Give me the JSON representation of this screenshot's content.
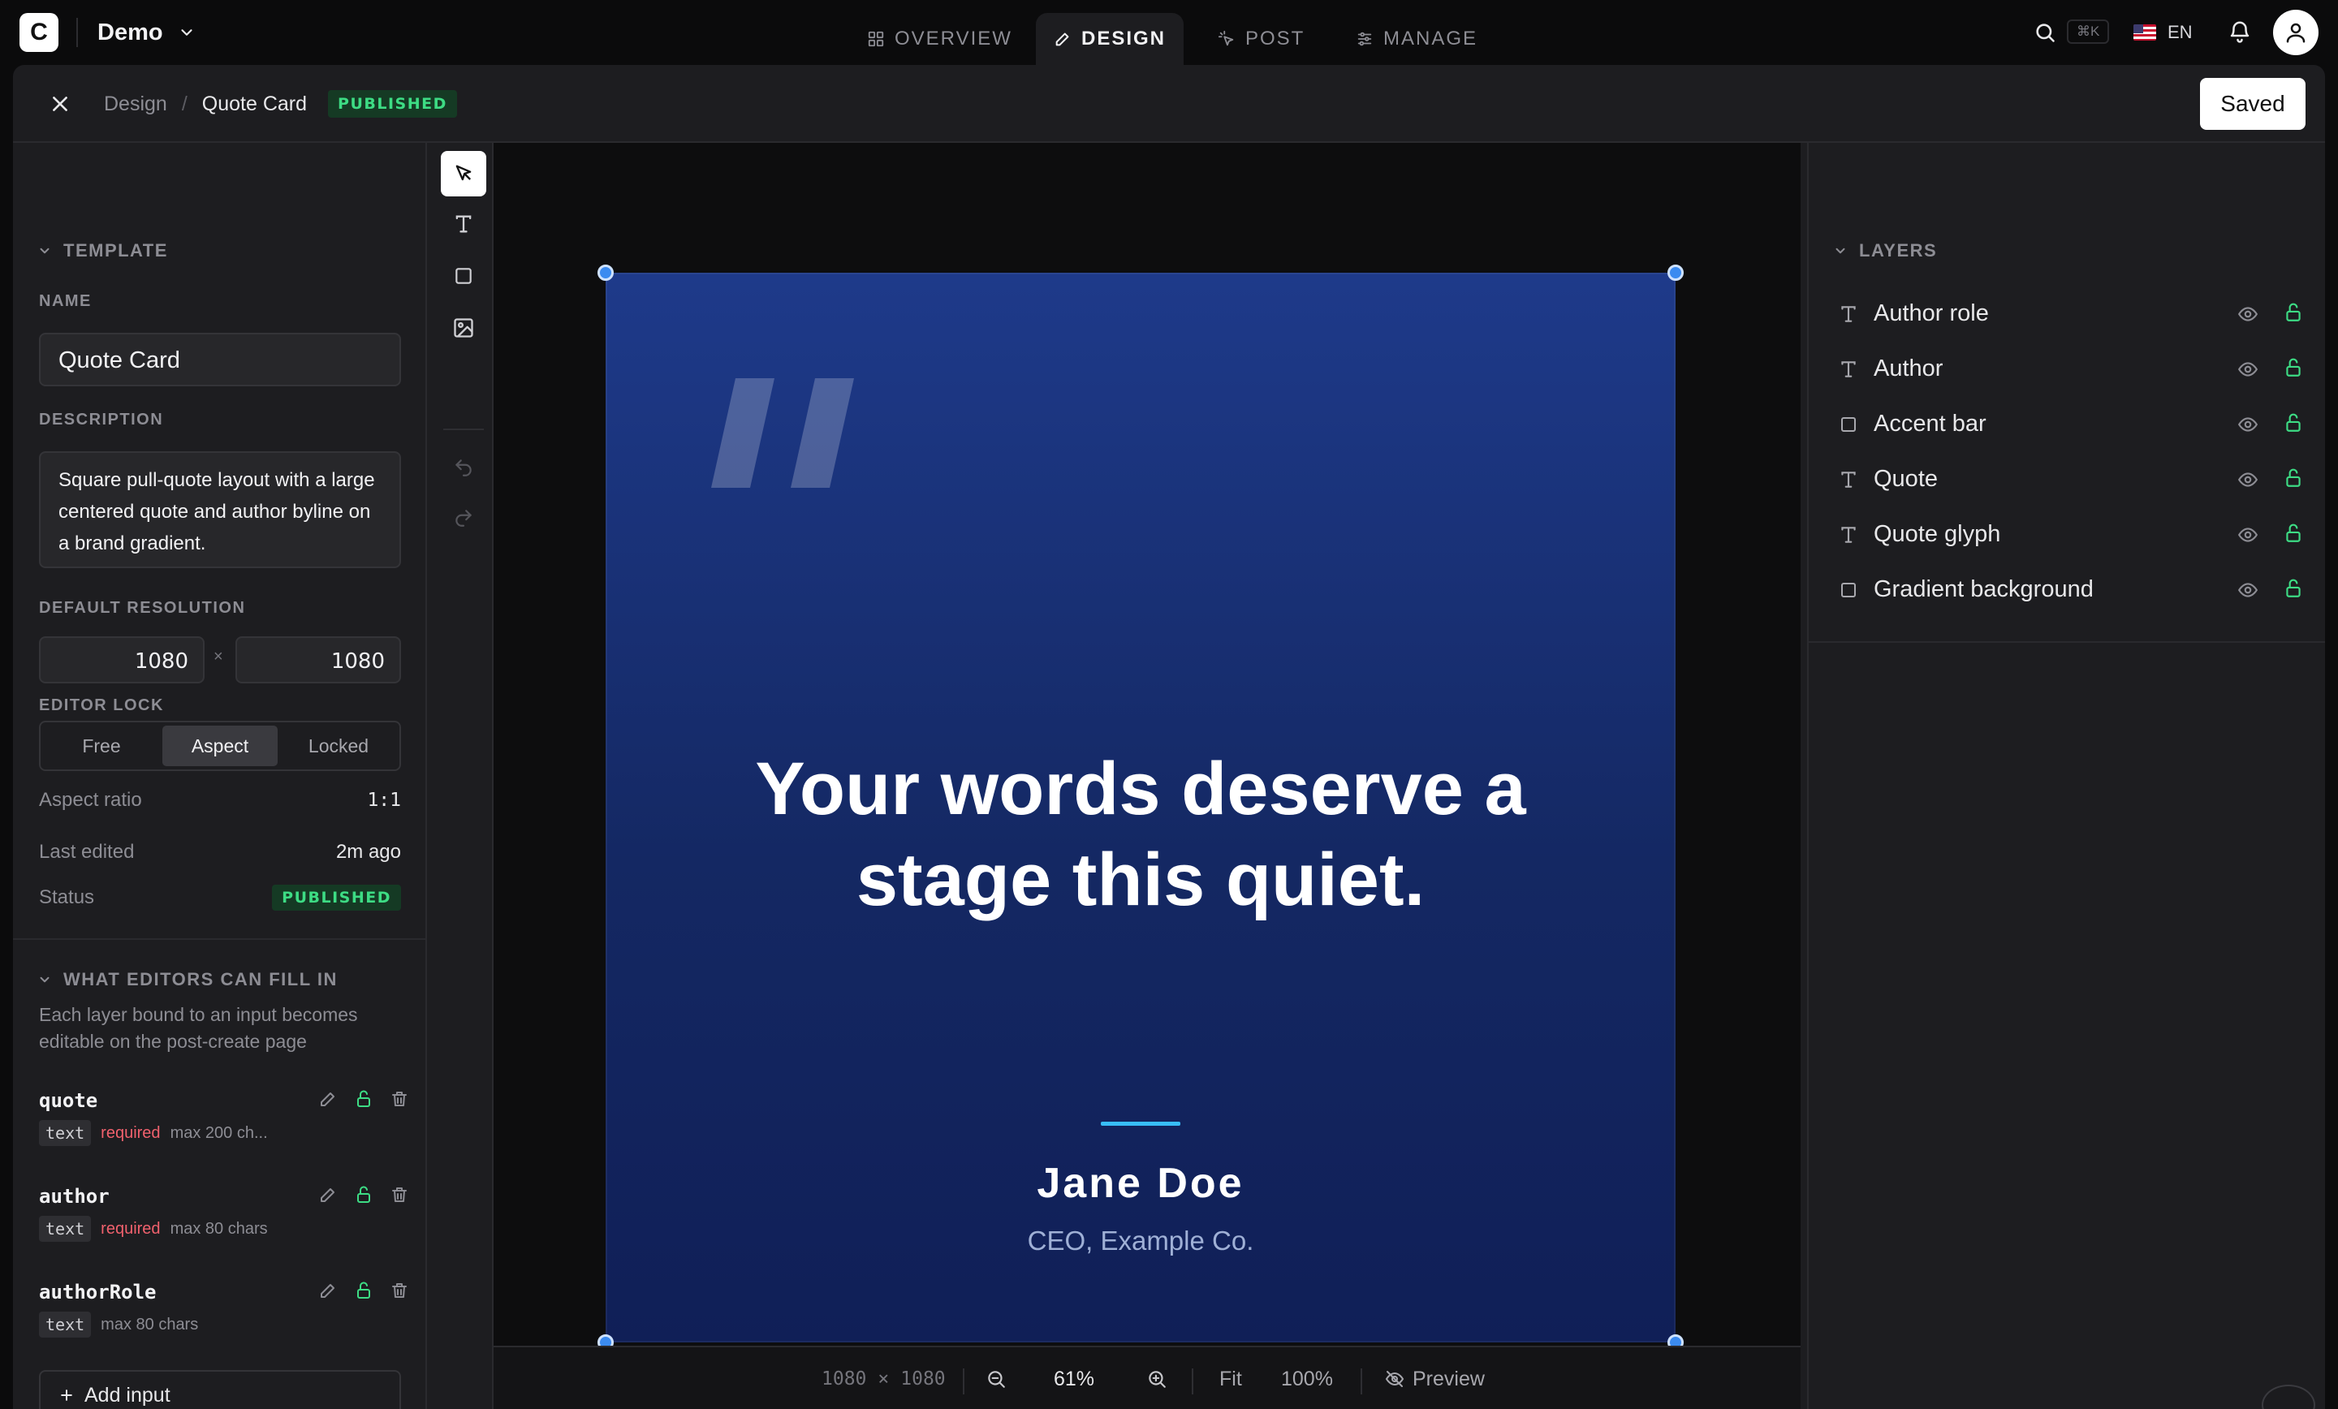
{
  "app": {
    "logo_letter": "C",
    "workspace": "Demo",
    "nav": [
      {
        "label": "OVERVIEW",
        "icon": "grid-icon"
      },
      {
        "label": "DESIGN",
        "icon": "pencil-icon"
      },
      {
        "label": "POST",
        "icon": "cursor-click-icon"
      },
      {
        "label": "MANAGE",
        "icon": "sliders-icon"
      }
    ],
    "active_nav": "DESIGN",
    "search_shortcut": "⌘K",
    "language": "EN"
  },
  "subheader": {
    "breadcrumb_root": "Design",
    "breadcrumb_sep": "/",
    "breadcrumb_current": "Quote Card",
    "status_badge": "PUBLISHED",
    "save_label": "Saved"
  },
  "template": {
    "section_title": "TEMPLATE",
    "name_label": "NAME",
    "name_value": "Quote Card",
    "description_label": "DESCRIPTION",
    "description_value": "Square pull-quote layout with a large centered quote and author byline on a brand gradient.",
    "resolution_label": "DEFAULT RESOLUTION",
    "width": "1080",
    "height": "1080",
    "times": "×",
    "lock_label": "EDITOR LOCK",
    "lock_options": [
      "Free",
      "Aspect",
      "Locked"
    ],
    "lock_selected": "Aspect",
    "aspect_label": "Aspect ratio",
    "aspect_value": "1:1",
    "edited_label": "Last edited",
    "edited_value": "2m ago",
    "status_label": "Status",
    "status_value": "PUBLISHED"
  },
  "fill": {
    "section_title": "WHAT EDITORS CAN FILL IN",
    "help": "Each layer bound to an input becomes editable on the post-create page",
    "items": [
      {
        "name": "quote",
        "type": "text",
        "required": "required",
        "max": "max 200 ch..."
      },
      {
        "name": "author",
        "type": "text",
        "required": "required",
        "max": "max 80 chars"
      },
      {
        "name": "authorRole",
        "type": "text",
        "required": "",
        "max": "max 80 chars"
      }
    ],
    "add_label": "Add input"
  },
  "canvas": {
    "quote": "Your words deserve a stage this quiet.",
    "author": "Jane Doe",
    "author_role": "CEO, Example Co.",
    "dimensions_w": "1080",
    "dimensions_x": "×",
    "dimensions_h": "1080",
    "zoom": "61%",
    "fit_label": "Fit",
    "hundred_label": "100%",
    "preview_label": "Preview",
    "brand_colors": {
      "gradient_top": "#1e3a8a",
      "gradient_bottom": "#101f57",
      "accent": "#38bdf8"
    }
  },
  "layers": {
    "section_title": "LAYERS",
    "items": [
      {
        "name": "Author role",
        "kind": "text"
      },
      {
        "name": "Author",
        "kind": "text"
      },
      {
        "name": "Accent bar",
        "kind": "rect"
      },
      {
        "name": "Quote",
        "kind": "text"
      },
      {
        "name": "Quote glyph",
        "kind": "text"
      },
      {
        "name": "Gradient background",
        "kind": "rect"
      }
    ]
  }
}
